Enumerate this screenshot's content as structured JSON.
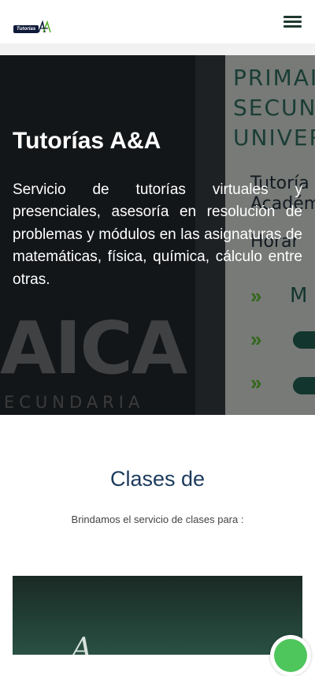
{
  "header": {
    "logo_text": "Tutorias",
    "logo_mark": "AA",
    "menu_icon": "hamburger-menu-icon"
  },
  "hero": {
    "title": "Tutorías A&A",
    "description": "Servicio de tutorías virtuales y presenciales, asesoría en resolución de problemas y módulos en las asignaturas de matemáticas, física, química, cálculo entre otras.",
    "bg_words": [
      "PRIMAI",
      "SECUN",
      "UNIVER"
    ],
    "bg_line1": "Tutoría",
    "bg_line2": "Académ",
    "bg_line3": "Horar",
    "bg_big": "AICA",
    "bg_sub": "ECUNDARIA",
    "bg_letter": "M"
  },
  "section": {
    "title": "Clases de",
    "subtitle": "Brindamos el servicio de clases para :"
  },
  "card": {
    "chalk_text": "A"
  },
  "floating": {
    "icon": "whatsapp-icon"
  },
  "colors": {
    "title_blue": "#1b3a5c",
    "menu_green": "#1f3a2e",
    "whatsapp_green": "#4ec65c"
  }
}
